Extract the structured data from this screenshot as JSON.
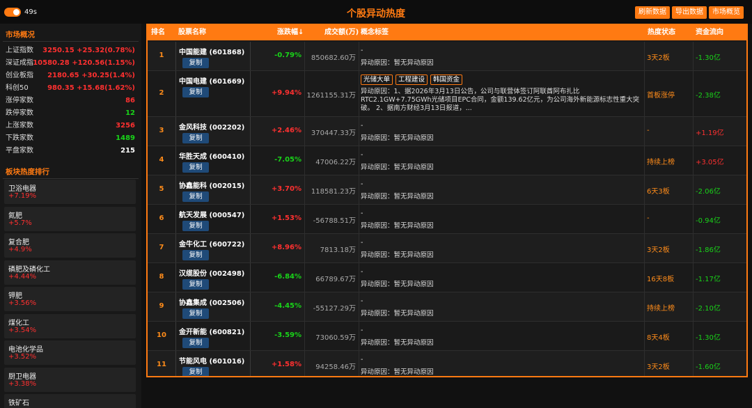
{
  "header": {
    "timer": "49s",
    "title": "个股异动热度",
    "buttons": [
      "刷新数据",
      "导出数据",
      "市场概览"
    ]
  },
  "sidebar": {
    "market_title": "市场概况",
    "overview": [
      {
        "label": "上证指数",
        "value": "3250.15 +25.32(0.78%)",
        "color": "red"
      },
      {
        "label": "深证成指",
        "value": "10580.28 +120.56(1.15%)",
        "color": "red"
      },
      {
        "label": "创业板指",
        "value": "2180.65 +30.25(1.4%)",
        "color": "red"
      },
      {
        "label": "科创50",
        "value": "980.35 +15.68(1.62%)",
        "color": "red"
      },
      {
        "label": "涨停家数",
        "value": "86",
        "color": "red"
      },
      {
        "label": "跌停家数",
        "value": "12",
        "color": "green"
      },
      {
        "label": "上涨家数",
        "value": "3256",
        "color": "red"
      },
      {
        "label": "下跌家数",
        "value": "1489",
        "color": "green"
      },
      {
        "label": "平盘家数",
        "value": "215",
        "color": "white"
      }
    ],
    "sector_title": "板块热度排行",
    "sectors": [
      {
        "name": "卫浴电器",
        "change": "+7.19%"
      },
      {
        "name": "氮肥",
        "change": "+5.7%"
      },
      {
        "name": "复合肥",
        "change": "+4.9%"
      },
      {
        "name": "磷肥及磷化工",
        "change": "+4.44%"
      },
      {
        "name": "钾肥",
        "change": "+3.56%"
      },
      {
        "name": "煤化工",
        "change": "+3.54%"
      },
      {
        "name": "电池化学品",
        "change": "+3.52%"
      },
      {
        "name": "厨卫电器",
        "change": "+3.38%"
      },
      {
        "name": "铁矿石",
        "change": ""
      }
    ]
  },
  "table": {
    "headers": [
      "排名",
      "股票名称",
      "涨跌幅↓",
      "成交额(万)",
      "概念标签",
      "热度状态",
      "资金流向"
    ],
    "copy_label": "复制",
    "rows": [
      {
        "rank": "1",
        "name": "中国能建 (601868)",
        "pct": "-0.79%",
        "pct_color": "green",
        "vol": "850682.60万",
        "tags": [],
        "dash": "-",
        "reason": "异动原因：暂无异动原因",
        "status": "3天2板",
        "flow": "-1.30亿",
        "flow_color": "green"
      },
      {
        "rank": "2",
        "name": "中国电建 (601669)",
        "pct": "+9.94%",
        "pct_color": "red",
        "vol": "1261155.31万",
        "tags": [
          "光储大单",
          "工程建设",
          "韩国资金"
        ],
        "dash": "",
        "reason": "异动原因：1、据2026年3月13日公告，公司与联营体签订阿联酋阿布扎比RTC2.1GW+7.75GWh光储项目EPC合同，金额139.62亿元，为公司海外新能源标志性重大突破。 2、据南方财经3月13日报道，...",
        "status": "首板涨停",
        "flow": "-2.38亿",
        "flow_color": "green"
      },
      {
        "rank": "3",
        "name": "金风科技 (002202)",
        "pct": "+2.46%",
        "pct_color": "red",
        "vol": "370447.33万",
        "tags": [],
        "dash": "-",
        "reason": "异动原因：暂无异动原因",
        "status": "-",
        "flow": "+1.19亿",
        "flow_color": "red"
      },
      {
        "rank": "4",
        "name": "华胜天成 (600410)",
        "pct": "-7.05%",
        "pct_color": "green",
        "vol": "47006.22万",
        "tags": [],
        "dash": "-",
        "reason": "异动原因：暂无异动原因",
        "status": "持续上榜",
        "flow": "+3.05亿",
        "flow_color": "red"
      },
      {
        "rank": "5",
        "name": "协鑫能科 (002015)",
        "pct": "+3.70%",
        "pct_color": "red",
        "vol": "118581.23万",
        "tags": [],
        "dash": "-",
        "reason": "异动原因：暂无异动原因",
        "status": "6天3板",
        "flow": "-2.06亿",
        "flow_color": "green"
      },
      {
        "rank": "6",
        "name": "航天发展 (000547)",
        "pct": "+1.53%",
        "pct_color": "red",
        "vol": "-56788.51万",
        "tags": [],
        "dash": "-",
        "reason": "异动原因：暂无异动原因",
        "status": "-",
        "flow": "-0.94亿",
        "flow_color": "green"
      },
      {
        "rank": "7",
        "name": "金牛化工 (600722)",
        "pct": "+8.96%",
        "pct_color": "red",
        "vol": "7813.18万",
        "tags": [],
        "dash": "-",
        "reason": "异动原因：暂无异动原因",
        "status": "3天2板",
        "flow": "-1.86亿",
        "flow_color": "green"
      },
      {
        "rank": "8",
        "name": "汉缆股份 (002498)",
        "pct": "-6.84%",
        "pct_color": "green",
        "vol": "66789.67万",
        "tags": [],
        "dash": "-",
        "reason": "异动原因：暂无异动原因",
        "status": "16天8板",
        "flow": "-1.17亿",
        "flow_color": "green"
      },
      {
        "rank": "9",
        "name": "协鑫集成 (002506)",
        "pct": "-4.45%",
        "pct_color": "green",
        "vol": "-55127.29万",
        "tags": [],
        "dash": "-",
        "reason": "异动原因：暂无异动原因",
        "status": "持续上榜",
        "flow": "-2.10亿",
        "flow_color": "green"
      },
      {
        "rank": "10",
        "name": "金开新能 (600821)",
        "pct": "-3.59%",
        "pct_color": "green",
        "vol": "73060.59万",
        "tags": [],
        "dash": "-",
        "reason": "异动原因：暂无异动原因",
        "status": "8天4板",
        "flow": "-1.30亿",
        "flow_color": "green"
      },
      {
        "rank": "11",
        "name": "节能风电 (601016)",
        "pct": "+1.58%",
        "pct_color": "red",
        "vol": "94258.46万",
        "tags": [],
        "dash": "-",
        "reason": "异动原因：暂无异动原因",
        "status": "3天2板",
        "flow": "-1.60亿",
        "flow_color": "green"
      }
    ]
  },
  "colors": {
    "accent": "#ff7a12",
    "up": "#ff3030",
    "down": "#19d419",
    "copy_button": "#1f4a78"
  }
}
